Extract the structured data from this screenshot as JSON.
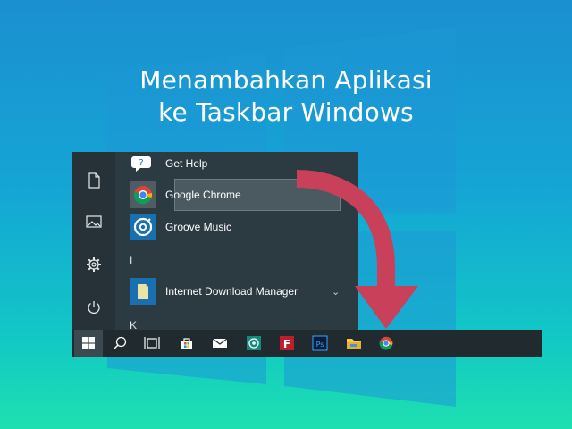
{
  "title": {
    "line1": "Menambahkan Aplikasi",
    "line2": "ke Taskbar Windows"
  },
  "start_menu": {
    "rail": [
      {
        "icon": "document-icon"
      },
      {
        "icon": "pictures-icon"
      },
      {
        "icon": "settings-gear-icon"
      },
      {
        "icon": "power-icon"
      }
    ],
    "apps": [
      {
        "label": "Get Help",
        "icon": "get-help-icon"
      },
      {
        "label": "Google Chrome",
        "icon": "chrome-icon",
        "highlighted": true
      },
      {
        "label": "Groove Music",
        "icon": "groove-music-icon"
      },
      {
        "label": "Internet Download Manager",
        "icon": "folder-icon",
        "expandable": true
      }
    ],
    "group_letters": [
      "I",
      "K"
    ]
  },
  "taskbar": {
    "items": [
      {
        "icon": "windows-start-icon"
      },
      {
        "icon": "search-icon"
      },
      {
        "icon": "task-view-icon"
      },
      {
        "icon": "store-icon"
      },
      {
        "icon": "mail-icon"
      },
      {
        "icon": "whatsapp-icon"
      },
      {
        "icon": "filezilla-icon"
      },
      {
        "icon": "photoshop-icon"
      },
      {
        "icon": "file-explorer-icon"
      },
      {
        "icon": "chrome-icon"
      }
    ]
  },
  "colors": {
    "arrow": "#c9405a",
    "taskbar": "#212a2e",
    "start_menu": "#2c3b42",
    "accent_tile": "#1a6fb0"
  }
}
